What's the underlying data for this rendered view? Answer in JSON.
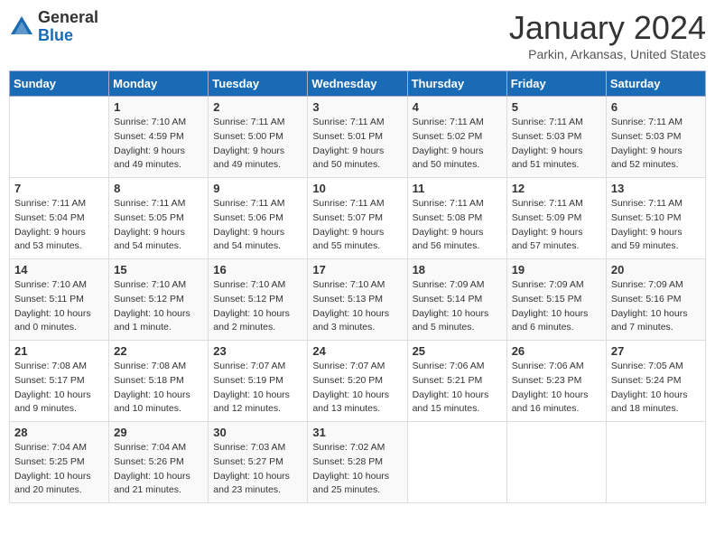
{
  "header": {
    "logo": {
      "general": "General",
      "blue": "Blue"
    },
    "title": "January 2024",
    "location": "Parkin, Arkansas, United States"
  },
  "calendar": {
    "weekdays": [
      "Sunday",
      "Monday",
      "Tuesday",
      "Wednesday",
      "Thursday",
      "Friday",
      "Saturday"
    ],
    "weeks": [
      [
        {
          "day": null
        },
        {
          "day": "1",
          "sunrise": "Sunrise: 7:10 AM",
          "sunset": "Sunset: 4:59 PM",
          "daylight": "Daylight: 9 hours and 49 minutes."
        },
        {
          "day": "2",
          "sunrise": "Sunrise: 7:11 AM",
          "sunset": "Sunset: 5:00 PM",
          "daylight": "Daylight: 9 hours and 49 minutes."
        },
        {
          "day": "3",
          "sunrise": "Sunrise: 7:11 AM",
          "sunset": "Sunset: 5:01 PM",
          "daylight": "Daylight: 9 hours and 50 minutes."
        },
        {
          "day": "4",
          "sunrise": "Sunrise: 7:11 AM",
          "sunset": "Sunset: 5:02 PM",
          "daylight": "Daylight: 9 hours and 50 minutes."
        },
        {
          "day": "5",
          "sunrise": "Sunrise: 7:11 AM",
          "sunset": "Sunset: 5:03 PM",
          "daylight": "Daylight: 9 hours and 51 minutes."
        },
        {
          "day": "6",
          "sunrise": "Sunrise: 7:11 AM",
          "sunset": "Sunset: 5:03 PM",
          "daylight": "Daylight: 9 hours and 52 minutes."
        }
      ],
      [
        {
          "day": "7",
          "sunrise": "Sunrise: 7:11 AM",
          "sunset": "Sunset: 5:04 PM",
          "daylight": "Daylight: 9 hours and 53 minutes."
        },
        {
          "day": "8",
          "sunrise": "Sunrise: 7:11 AM",
          "sunset": "Sunset: 5:05 PM",
          "daylight": "Daylight: 9 hours and 54 minutes."
        },
        {
          "day": "9",
          "sunrise": "Sunrise: 7:11 AM",
          "sunset": "Sunset: 5:06 PM",
          "daylight": "Daylight: 9 hours and 54 minutes."
        },
        {
          "day": "10",
          "sunrise": "Sunrise: 7:11 AM",
          "sunset": "Sunset: 5:07 PM",
          "daylight": "Daylight: 9 hours and 55 minutes."
        },
        {
          "day": "11",
          "sunrise": "Sunrise: 7:11 AM",
          "sunset": "Sunset: 5:08 PM",
          "daylight": "Daylight: 9 hours and 56 minutes."
        },
        {
          "day": "12",
          "sunrise": "Sunrise: 7:11 AM",
          "sunset": "Sunset: 5:09 PM",
          "daylight": "Daylight: 9 hours and 57 minutes."
        },
        {
          "day": "13",
          "sunrise": "Sunrise: 7:11 AM",
          "sunset": "Sunset: 5:10 PM",
          "daylight": "Daylight: 9 hours and 59 minutes."
        }
      ],
      [
        {
          "day": "14",
          "sunrise": "Sunrise: 7:10 AM",
          "sunset": "Sunset: 5:11 PM",
          "daylight": "Daylight: 10 hours and 0 minutes."
        },
        {
          "day": "15",
          "sunrise": "Sunrise: 7:10 AM",
          "sunset": "Sunset: 5:12 PM",
          "daylight": "Daylight: 10 hours and 1 minute."
        },
        {
          "day": "16",
          "sunrise": "Sunrise: 7:10 AM",
          "sunset": "Sunset: 5:12 PM",
          "daylight": "Daylight: 10 hours and 2 minutes."
        },
        {
          "day": "17",
          "sunrise": "Sunrise: 7:10 AM",
          "sunset": "Sunset: 5:13 PM",
          "daylight": "Daylight: 10 hours and 3 minutes."
        },
        {
          "day": "18",
          "sunrise": "Sunrise: 7:09 AM",
          "sunset": "Sunset: 5:14 PM",
          "daylight": "Daylight: 10 hours and 5 minutes."
        },
        {
          "day": "19",
          "sunrise": "Sunrise: 7:09 AM",
          "sunset": "Sunset: 5:15 PM",
          "daylight": "Daylight: 10 hours and 6 minutes."
        },
        {
          "day": "20",
          "sunrise": "Sunrise: 7:09 AM",
          "sunset": "Sunset: 5:16 PM",
          "daylight": "Daylight: 10 hours and 7 minutes."
        }
      ],
      [
        {
          "day": "21",
          "sunrise": "Sunrise: 7:08 AM",
          "sunset": "Sunset: 5:17 PM",
          "daylight": "Daylight: 10 hours and 9 minutes."
        },
        {
          "day": "22",
          "sunrise": "Sunrise: 7:08 AM",
          "sunset": "Sunset: 5:18 PM",
          "daylight": "Daylight: 10 hours and 10 minutes."
        },
        {
          "day": "23",
          "sunrise": "Sunrise: 7:07 AM",
          "sunset": "Sunset: 5:19 PM",
          "daylight": "Daylight: 10 hours and 12 minutes."
        },
        {
          "day": "24",
          "sunrise": "Sunrise: 7:07 AM",
          "sunset": "Sunset: 5:20 PM",
          "daylight": "Daylight: 10 hours and 13 minutes."
        },
        {
          "day": "25",
          "sunrise": "Sunrise: 7:06 AM",
          "sunset": "Sunset: 5:21 PM",
          "daylight": "Daylight: 10 hours and 15 minutes."
        },
        {
          "day": "26",
          "sunrise": "Sunrise: 7:06 AM",
          "sunset": "Sunset: 5:23 PM",
          "daylight": "Daylight: 10 hours and 16 minutes."
        },
        {
          "day": "27",
          "sunrise": "Sunrise: 7:05 AM",
          "sunset": "Sunset: 5:24 PM",
          "daylight": "Daylight: 10 hours and 18 minutes."
        }
      ],
      [
        {
          "day": "28",
          "sunrise": "Sunrise: 7:04 AM",
          "sunset": "Sunset: 5:25 PM",
          "daylight": "Daylight: 10 hours and 20 minutes."
        },
        {
          "day": "29",
          "sunrise": "Sunrise: 7:04 AM",
          "sunset": "Sunset: 5:26 PM",
          "daylight": "Daylight: 10 hours and 21 minutes."
        },
        {
          "day": "30",
          "sunrise": "Sunrise: 7:03 AM",
          "sunset": "Sunset: 5:27 PM",
          "daylight": "Daylight: 10 hours and 23 minutes."
        },
        {
          "day": "31",
          "sunrise": "Sunrise: 7:02 AM",
          "sunset": "Sunset: 5:28 PM",
          "daylight": "Daylight: 10 hours and 25 minutes."
        },
        {
          "day": null
        },
        {
          "day": null
        },
        {
          "day": null
        }
      ]
    ]
  }
}
